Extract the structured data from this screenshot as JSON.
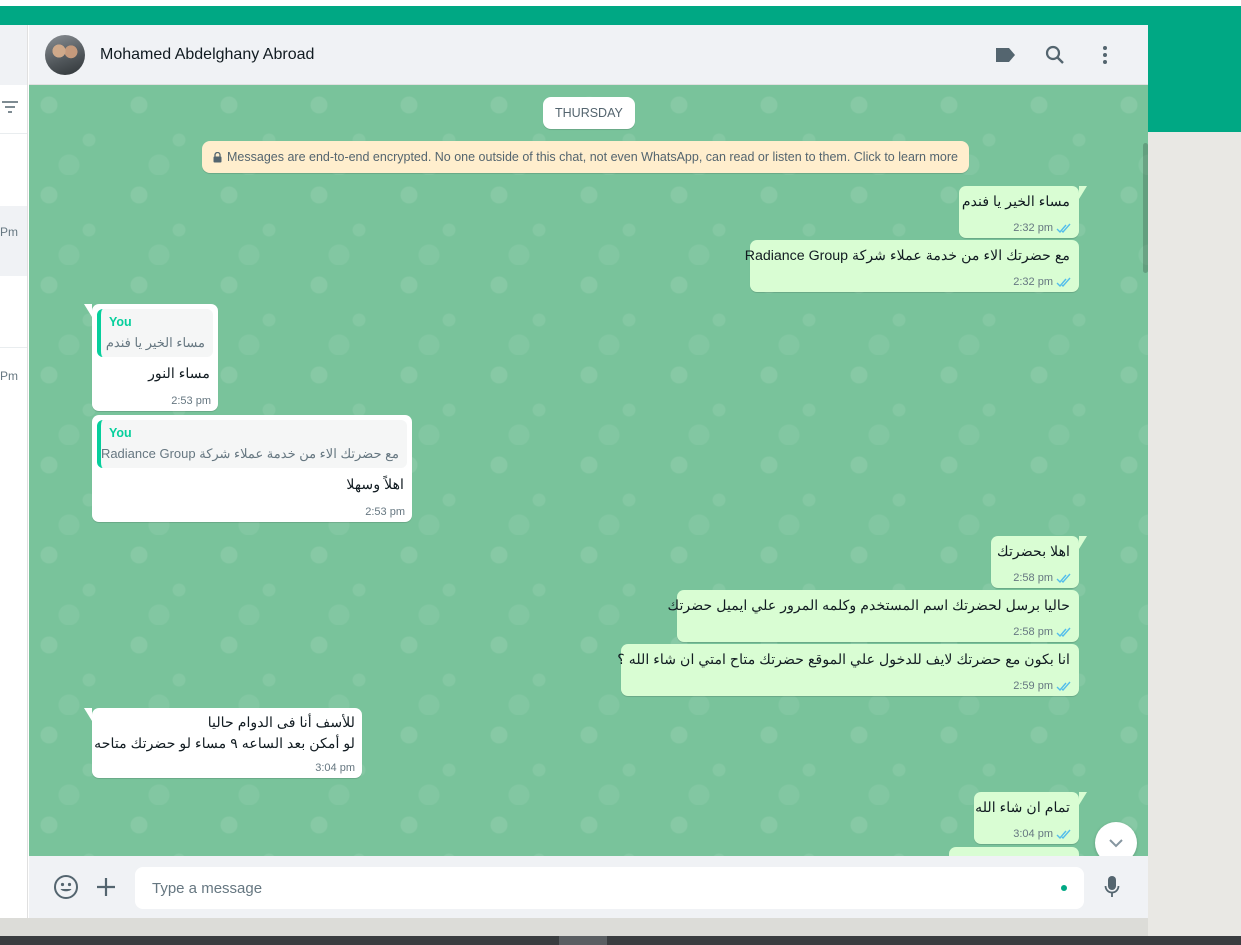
{
  "header": {
    "contact_name": "Mohamed Abdelghany Abroad",
    "icons": [
      "label-icon",
      "search-icon",
      "menu-icon"
    ]
  },
  "sidebar": {
    "times": [
      "Pm",
      "Pm"
    ]
  },
  "chat": {
    "day_label": "THURSDAY",
    "encryption_notice": "Messages are end-to-end encrypted. No one outside of this chat, not even WhatsApp, can read or listen to them. Click to learn more",
    "messages": [
      {
        "dir": "out",
        "text": "مساء الخير يا فندم",
        "time": "2:32 pm"
      },
      {
        "dir": "out",
        "text": "مع حضرتك الاء من خدمة عملاء شركة Radiance Group",
        "time": "2:32 pm"
      },
      {
        "dir": "in",
        "quote_author": "You",
        "quote_text": "مساء الخير يا فندم",
        "text": "مساء النور",
        "time": "2:53 pm"
      },
      {
        "dir": "in",
        "quote_author": "You",
        "quote_text": "مع حضرتك الاء من خدمة عملاء شركة Radiance Group",
        "text": "اهلاً وسهلا",
        "time": "2:53 pm"
      },
      {
        "dir": "out",
        "text": "اهلا بحضرتك",
        "time": "2:58 pm"
      },
      {
        "dir": "out",
        "text": "حاليا برسل لحضرتك اسم المستخدم وكلمه المرور علي ايميل حضرتك",
        "time": "2:58 pm"
      },
      {
        "dir": "out",
        "text": "انا بكون مع حضرتك لايف للدخول علي الموقع حضرتك متاح امتي ان شاء الله ؟",
        "time": "2:59 pm"
      },
      {
        "dir": "in",
        "text_line1": "للأسف أنا فى الدوام حاليا",
        "text_line2": "لو أمكن بعد الساعه ٩ مساء لو حضرتك متاحه",
        "time": "3:04 pm"
      },
      {
        "dir": "out",
        "text": "تمام ان شاء الله",
        "time": "3:04 pm"
      }
    ]
  },
  "footer": {
    "placeholder": "Type a message"
  },
  "colors": {
    "brand": "#00a884",
    "outgoing_bubble": "#d9fdd3",
    "incoming_bubble": "#ffffff",
    "chat_background": "#79c39b",
    "read_ticks": "#53bdeb"
  }
}
